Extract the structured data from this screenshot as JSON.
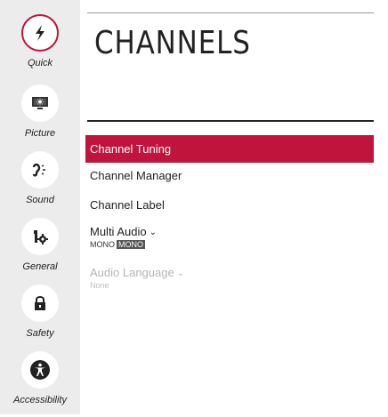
{
  "sidebar": {
    "items": [
      {
        "label": "Quick",
        "icon": "lightning-icon"
      },
      {
        "label": "Picture",
        "icon": "picture-icon"
      },
      {
        "label": "Sound",
        "icon": "sound-icon"
      },
      {
        "label": "General",
        "icon": "general-icon"
      },
      {
        "label": "Safety",
        "icon": "lock-icon"
      },
      {
        "label": "Accessibility",
        "icon": "accessibility-icon"
      }
    ],
    "active": "Quick"
  },
  "header": {
    "title": "CHANNELS"
  },
  "menu": {
    "items": [
      {
        "label": "Channel Tuning",
        "state": "selected"
      },
      {
        "label": "Channel Manager"
      },
      {
        "label": "Channel Label"
      },
      {
        "label": "Multi Audio",
        "value": "MONO",
        "badge": "MONO"
      },
      {
        "label": "Audio Language",
        "value": "None",
        "state": "disabled"
      }
    ]
  },
  "colors": {
    "accent": "#c0143c",
    "sidebar_bg": "#ececec",
    "disabled_text": "#b4b4b4"
  }
}
